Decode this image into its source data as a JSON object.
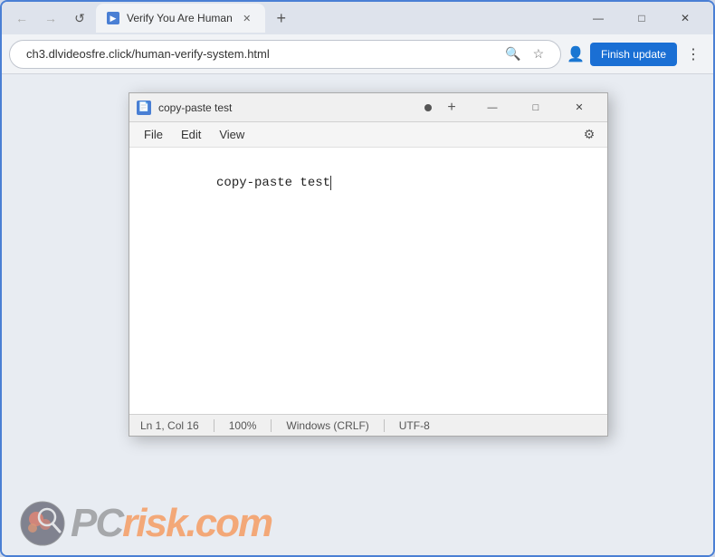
{
  "browser": {
    "tab": {
      "title": "Verify You Are Human",
      "favicon_color": "#4a7fd4"
    },
    "address": "ch3.dlvideosfre.click/human-verify-system.html",
    "finish_update_label": "Finish update",
    "controls": {
      "minimize": "—",
      "maximize": "□",
      "close": "✕"
    }
  },
  "notepad": {
    "title": "copy-paste test",
    "menu": {
      "file": "File",
      "edit": "Edit",
      "view": "View"
    },
    "content": "copy-paste test",
    "status": {
      "position": "Ln 1, Col 16",
      "zoom": "100%",
      "line_ending": "Windows (CRLF)",
      "encoding": "UTF-8"
    },
    "controls": {
      "minimize": "—",
      "maximize": "□",
      "close": "✕",
      "new_tab": "+"
    }
  },
  "watermark": {
    "text_pc": "PC",
    "text_risk": "risk",
    "text_com": ".com"
  },
  "icons": {
    "back": "←",
    "forward": "→",
    "refresh": "↺",
    "search": "🔍",
    "bookmark": "☆",
    "profile": "👤",
    "menu": "⋮",
    "gear": "⚙",
    "document": "📄"
  }
}
